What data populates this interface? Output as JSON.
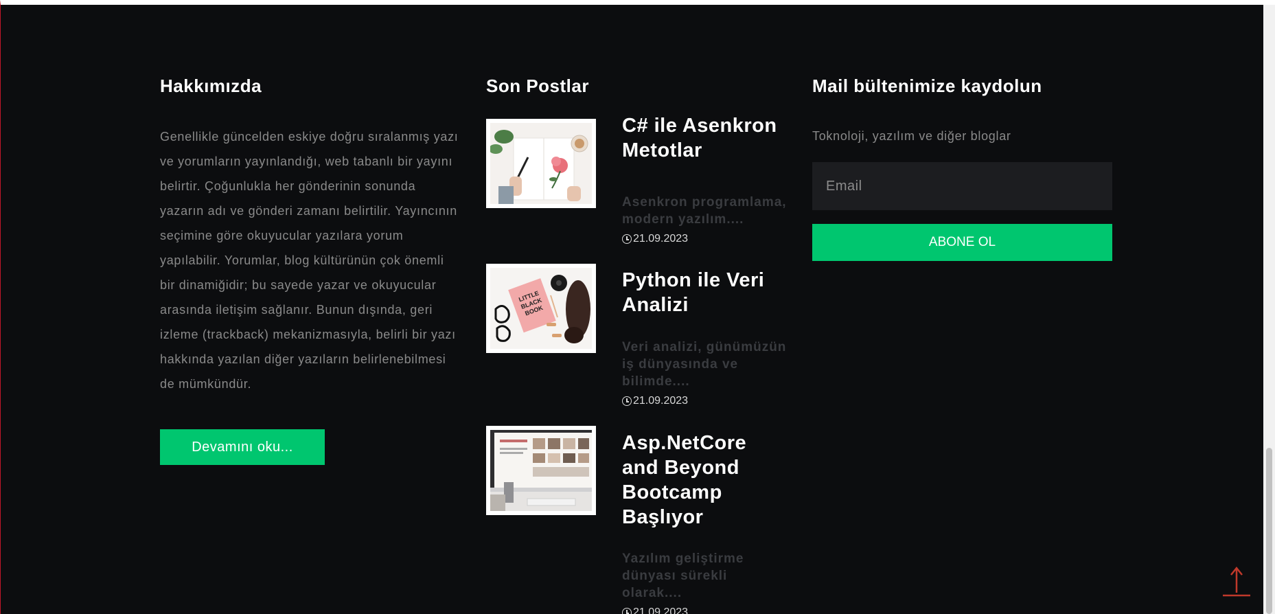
{
  "about": {
    "heading": "Hakkımızda",
    "text": "Genellikle güncelden eskiye doğru sıralanmış yazı ve yorumların yayınlandığı, web tabanlı bir yayını belirtir. Çoğunlukla her gönderinin sonunda yazarın adı ve gönderi zamanı belirtilir. Yayıncının seçimine göre okuyucular yazılara yorum yapılabilir. Yorumlar, blog kültürünün çok önemli bir dinamiğidir; bu sayede yazar ve okuyucular arasında iletişim sağlanır. Bunun dışında, geri izleme (trackback) mekanizmasıyla, belirli bir yazı hakkında yazılan diğer yazıların belirlenebilmesi de mümkündür.",
    "button_label": "Devamını oku..."
  },
  "posts": {
    "heading": "Son Postlar",
    "items": [
      {
        "title": "C# ile Asenkron Metotlar",
        "excerpt": "Asenkron programlama, modern yazılım....",
        "date": "21.09.2023",
        "image": "notebook-flower-photo"
      },
      {
        "title": "Python ile Veri Analizi",
        "excerpt": "Veri analizi, günümüzün iş dünyasında ve bilimde....",
        "date": "21.09.2023",
        "image": "little-black-book-photo"
      },
      {
        "title": "Asp.NetCore and Beyond Bootcamp Başlıyor",
        "excerpt": "Yazılım geliştirme dünyası sürekli olarak....",
        "date": "21.09.2023",
        "image": "desk-monitor-photo"
      }
    ]
  },
  "newsletter": {
    "heading": "Mail bültenimize kaydolun",
    "text": "Toknoloji, yazılım ve diğer bloglar",
    "email_placeholder": "Email",
    "button_label": "ABONE OL"
  },
  "icons": {
    "date": "clock-icon",
    "back_to_top": "arrow-up-icon"
  },
  "colors": {
    "background": "#0c0d0f",
    "accent": "#00c66f",
    "input_bg": "#1c1d20",
    "to_top": "#c0392b"
  }
}
